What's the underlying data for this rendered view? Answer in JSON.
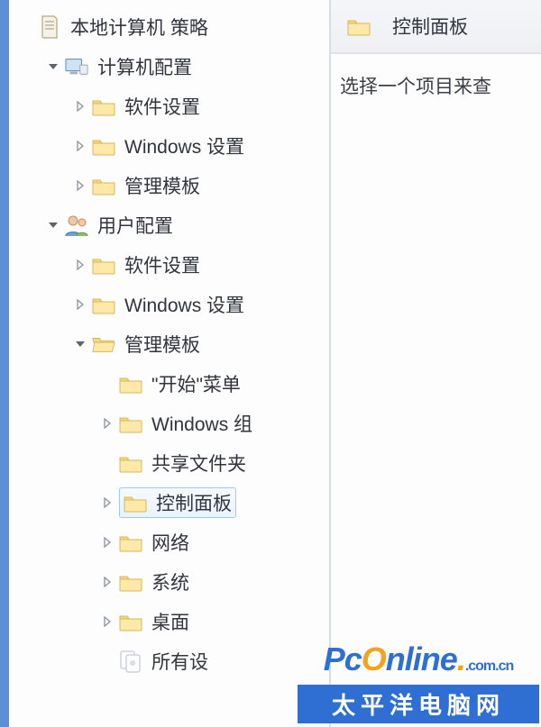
{
  "tree": {
    "root": {
      "label": "本地计算机 策略"
    },
    "computer_cfg": {
      "label": "计算机配置"
    },
    "comp_soft": {
      "label": "软件设置"
    },
    "comp_win": {
      "label": "Windows 设置"
    },
    "comp_admin": {
      "label": "管理模板"
    },
    "user_cfg": {
      "label": "用户配置"
    },
    "user_soft": {
      "label": "软件设置"
    },
    "user_win": {
      "label": "Windows 设置"
    },
    "user_admin": {
      "label": "管理模板"
    },
    "start_menu": {
      "label": "\"开始\"菜单"
    },
    "win_comp": {
      "label": "Windows 组"
    },
    "shared": {
      "label": "共享文件夹"
    },
    "ctrl_panel": {
      "label": "控制面板"
    },
    "network": {
      "label": "网络"
    },
    "system": {
      "label": "系统"
    },
    "desktop": {
      "label": "桌面"
    },
    "all_set": {
      "label": "所有设"
    }
  },
  "right": {
    "header": "控制面板",
    "body": "选择一个项目来查"
  },
  "watermark": {
    "brand_a": "P",
    "brand_b": "c",
    "brand_c": "nline",
    "brand_o": "O",
    "suffix": ".com.cn",
    "cn": "太平洋电脑网"
  }
}
